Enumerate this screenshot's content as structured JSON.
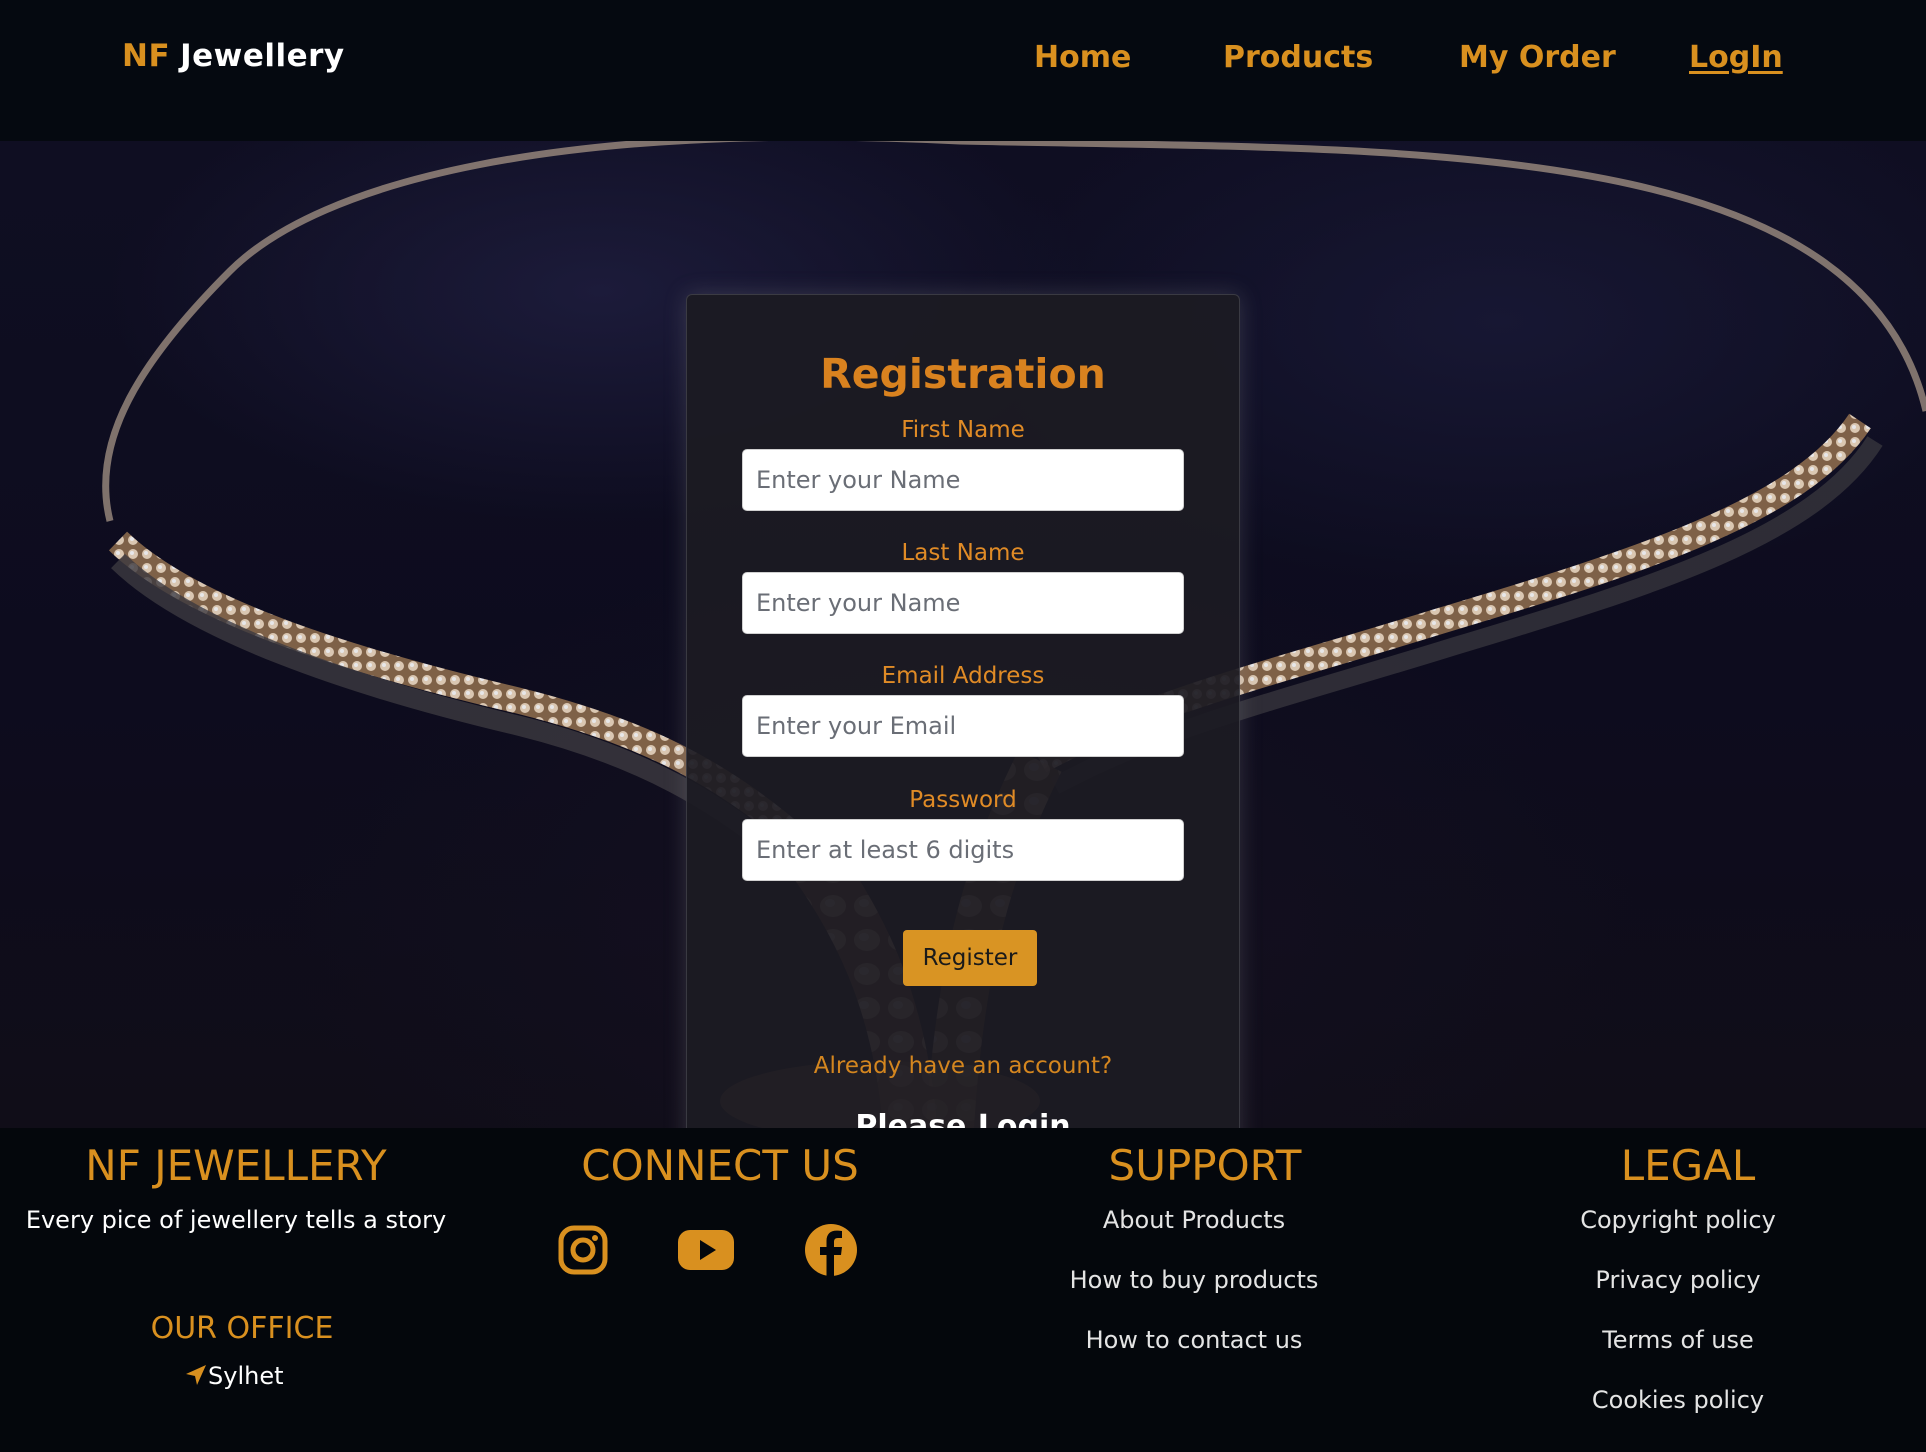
{
  "nav": {
    "brand_first": "NF",
    "brand_second": "Jewellery",
    "links": [
      {
        "label": "Home"
      },
      {
        "label": "Products"
      },
      {
        "label": "My Order"
      },
      {
        "label": "LogIn"
      }
    ]
  },
  "form": {
    "title": "Registration",
    "fields": [
      {
        "label": "First Name",
        "placeholder": "Enter your Name",
        "value": ""
      },
      {
        "label": "Last Name",
        "placeholder": "Enter your Name",
        "value": ""
      },
      {
        "label": "Email Address",
        "placeholder": "Enter your Email",
        "value": ""
      },
      {
        "label": "Password",
        "placeholder": "Enter at least 6 digits",
        "value": ""
      }
    ],
    "register_label": "Register",
    "already_text": "Already have an account?",
    "login_link": "Please,Login"
  },
  "footer": {
    "brand": {
      "heading": "NF JEWELLERY",
      "tagline": "Every pice of jewellery tells a story",
      "office_heading": "OUR OFFICE",
      "office_location": "Sylhet"
    },
    "connect": {
      "heading": "CONNECT US",
      "icons": [
        "instagram-icon",
        "youtube-icon",
        "facebook-icon"
      ]
    },
    "support": {
      "heading": "SUPPORT",
      "links": [
        "About Products",
        "How to buy products",
        "How to contact us"
      ]
    },
    "legal": {
      "heading": "LEGAL",
      "links": [
        "Copyright policy",
        "Privacy policy",
        "Terms of use",
        "Cookies policy"
      ]
    }
  },
  "colors": {
    "accent": "#d9901f",
    "navbar_bg": "#050910",
    "card_bg": "#1c1b22",
    "button_bg": "#d99423",
    "link_underline": "#3b7de0"
  }
}
